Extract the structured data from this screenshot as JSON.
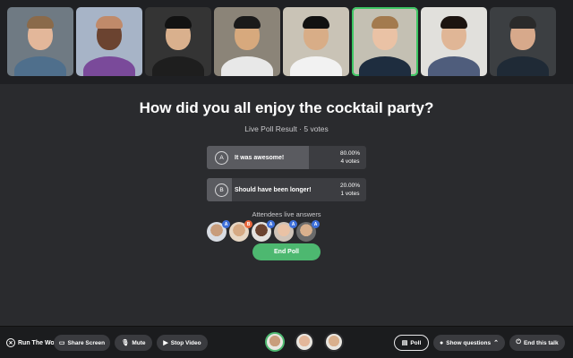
{
  "participants": [
    {
      "name": "participant-1",
      "bg": "#6f7a83",
      "skin": "#e3b79a",
      "hair": "#8a6a4a",
      "shirt": "#4f6f8c",
      "active": false
    },
    {
      "name": "participant-2",
      "bg": "#a7b4c7",
      "skin": "#6b4330",
      "hair": "#c08a6a",
      "shirt": "#7a4a9a",
      "active": false
    },
    {
      "name": "participant-3",
      "bg": "#343434",
      "skin": "#d9b08d",
      "hair": "#121212",
      "shirt": "#1e1e1e",
      "active": false
    },
    {
      "name": "participant-4",
      "bg": "#8b8478",
      "skin": "#d7a97d",
      "hair": "#1a1a1a",
      "shirt": "#e8e8e8",
      "active": false
    },
    {
      "name": "participant-5",
      "bg": "#c9c3b6",
      "skin": "#d8ad87",
      "hair": "#111111",
      "shirt": "#f2f2f2",
      "active": false
    },
    {
      "name": "participant-6",
      "bg": "#c4c0b3",
      "skin": "#eac2a5",
      "hair": "#a37a4e",
      "shirt": "#1e2d3f",
      "active": true
    },
    {
      "name": "participant-7",
      "bg": "#e1e0dc",
      "skin": "#e0b696",
      "hair": "#1c1410",
      "shirt": "#4f5d7c",
      "active": false
    },
    {
      "name": "participant-8",
      "bg": "#3c3f42",
      "skin": "#d7a98b",
      "hair": "#2a2a2a",
      "shirt": "#1f2a36",
      "active": false
    }
  ],
  "poll": {
    "question": "How did you all enjoy the cocktail party?",
    "subtitle": "Live Poll Result · 5 votes",
    "options": [
      {
        "letter": "A",
        "label": "It was awesome!",
        "percent": "80.00%",
        "votes": "4 votes",
        "fraction": 0.8
      },
      {
        "letter": "B",
        "label": "Should have been longer!",
        "percent": "20.00%",
        "votes": "1 votes",
        "fraction": 0.2
      }
    ],
    "attendees_label": "Attendees live answers",
    "attendee_answers": [
      {
        "letter": "A",
        "face": "#c89d7c",
        "bg": "#d9dde3",
        "tag": "#3d6fd9"
      },
      {
        "letter": "B",
        "face": "#d6aa84",
        "bg": "#e7d7c4",
        "tag": "#e8663b"
      },
      {
        "letter": "A",
        "face": "#6b4330",
        "bg": "#e3e1de",
        "tag": "#3d6fd9"
      },
      {
        "letter": "A",
        "face": "#eac2a5",
        "bg": "#cfc3b8",
        "tag": "#3d6fd9"
      },
      {
        "letter": "A",
        "face": "#d9b08d",
        "bg": "#6b6b6b",
        "tag": "#3d6fd9"
      }
    ],
    "end_label": "End Poll"
  },
  "toolbar": {
    "brand": "Run The World",
    "share_screen": "Share Screen",
    "mute": "Mute",
    "stop_video": "Stop Video",
    "poll": "Poll",
    "show_questions": "Show questions",
    "end_talk": "End this talk"
  },
  "speakers": [
    {
      "face": "#c89d7c",
      "ring": true
    },
    {
      "face": "#e3b79a",
      "ring": false
    },
    {
      "face": "#d9b08d",
      "ring": false
    }
  ],
  "colors": {
    "accent": "#4db870",
    "background": "#2a2b2e",
    "answer_a_tag": "#3d6fd9",
    "answer_b_tag": "#e8663b"
  },
  "icons": [
    "share-screen-icon",
    "microphone-icon",
    "video-camera-icon",
    "poll-icon",
    "chat-bubble-icon",
    "chevron-up-icon",
    "power-icon"
  ]
}
